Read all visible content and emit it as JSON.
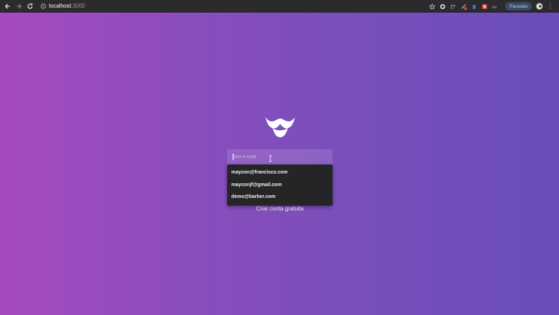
{
  "browser": {
    "address_host": "localhost",
    "address_port": ":3000",
    "paused_label": "Pausada",
    "menu_icon": "more-vert-icon",
    "extension_icons": [
      "bookmark-star-icon",
      "extension-shield-icon",
      "extension-f-icon",
      "extension-pen-icon",
      "extension-dropbox-icon",
      "extension-red-icon",
      "extension-grey-icon"
    ]
  },
  "page": {
    "logo_icon": "mustache-logo-icon",
    "email_placeholder": "Seu e-mail",
    "autofill_suggestions": [
      "maycon@francisco.com",
      "mayconjf@gmail.com",
      "demo@barber.com"
    ],
    "create_account_label": "Criar conta gratuita"
  },
  "colors": {
    "gradient_left": "#a64bbf",
    "gradient_right": "#6a4db8",
    "dropdown_bg": "#252527",
    "toolbar_bg": "#2b2b2e"
  }
}
